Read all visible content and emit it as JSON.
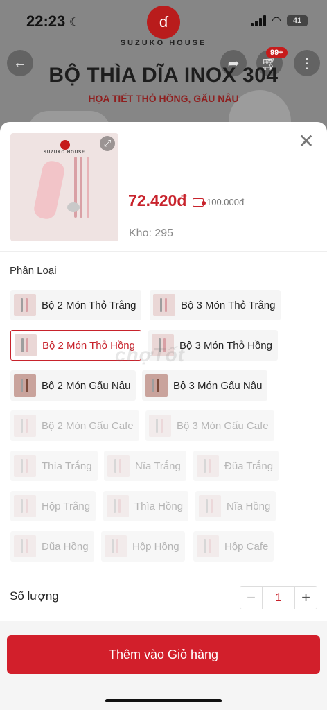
{
  "status": {
    "time": "22:23",
    "battery": "41"
  },
  "brand": {
    "name": "SUZUKO HOUSE",
    "color": "#b91c1c"
  },
  "header": {
    "cart_count": "99+",
    "hero_title": "BỘ THÌA DĨA INOX 304",
    "hero_subtitle": "HỌA TIẾT THỎ HỒNG, GẤU NÂU"
  },
  "product": {
    "price": "72.420đ",
    "original_price": "100.000đ",
    "stock": "Kho: 295"
  },
  "variants": {
    "label": "Phân Loại",
    "items": [
      {
        "label": "Bộ 2 Món Thỏ Trắng",
        "state": "normal"
      },
      {
        "label": "Bộ 3 Món Thỏ Trắng",
        "state": "normal"
      },
      {
        "label": "Bộ 2 Món Thỏ Hồng",
        "state": "selected"
      },
      {
        "label": "Bộ 3 Món Thỏ Hồng",
        "state": "normal"
      },
      {
        "label": "Bộ 2 Món Gấu Nâu",
        "state": "normal"
      },
      {
        "label": "Bộ 3 Món Gấu Nâu",
        "state": "normal"
      },
      {
        "label": "Bộ 2 Món Gấu Cafe",
        "state": "disabled"
      },
      {
        "label": "Bộ 3 Món Gấu Cafe",
        "state": "disabled"
      },
      {
        "label": "Thìa Trắng",
        "state": "disabled"
      },
      {
        "label": "Nĩa Trắng",
        "state": "disabled"
      },
      {
        "label": "Đũa Trắng",
        "state": "disabled"
      },
      {
        "label": "Hộp Trắng",
        "state": "disabled"
      },
      {
        "label": "Thìa Hồng",
        "state": "disabled"
      },
      {
        "label": "Nĩa Hồng",
        "state": "disabled"
      },
      {
        "label": "Đũa Hồng",
        "state": "disabled"
      },
      {
        "label": "Hộp Hồng",
        "state": "disabled"
      },
      {
        "label": "Hộp Cafe",
        "state": "disabled"
      }
    ]
  },
  "quantity": {
    "label": "Số lượng",
    "value": "1"
  },
  "actions": {
    "add_to_cart": "Thêm vào Giỏ hàng"
  },
  "watermark": "chợTốt",
  "colors": {
    "accent": "#d21f2b",
    "price": "#c8232c"
  }
}
